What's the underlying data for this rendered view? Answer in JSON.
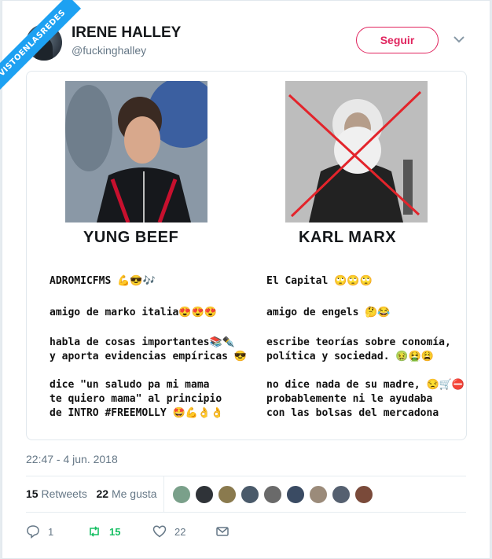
{
  "header": {
    "watermark": "VISTOENLASREDES",
    "display_name": "IRENE HALLEY",
    "handle": "@fuckinghalley",
    "follow_label": "Seguir"
  },
  "image": {
    "left_title": "YUNG BEEF",
    "right_title": "KARL MARX",
    "left_items": [
      [
        "ADROMICFMS 💪😎🎶"
      ],
      [
        "amigo de marko italia😍😍😍"
      ],
      [
        "habla de cosas importantes📚✒️",
        "y aporta evidencias empíricas 😎"
      ],
      [
        "dice \"un saludo pa mi mama",
        "te quiero mama\" al principio",
        "de INTRO #FREEMOLLY 🤩💪👌👌"
      ]
    ],
    "right_items": [
      [
        "El Capital  🙄🙄🙄"
      ],
      [
        "amigo de engels 🤔😂"
      ],
      [
        "escribe teorías sobre conomía,",
        "política y sociedad. 🤢🤮😩"
      ],
      [
        "no dice nada de su madre, 😒🛒⛔",
        "probablemente ni le ayudaba",
        "con las bolsas del mercadona"
      ]
    ]
  },
  "tweet": {
    "timestamp": "22:47 - 4 jun. 2018",
    "retweets_count": "15",
    "retweets_label": "Retweets",
    "likes_count": "22",
    "likes_label": "Me gusta"
  },
  "actions": {
    "reply_count": "1",
    "retweet_count": "15",
    "like_count": "22"
  },
  "colors": {
    "accent": "#1da1f2",
    "follow": "#e0245e",
    "retweet": "#17bf63",
    "muted": "#657786"
  },
  "likers": [
    "liker-1",
    "liker-2",
    "liker-3",
    "liker-4",
    "liker-5",
    "liker-6",
    "liker-7",
    "liker-8",
    "liker-9"
  ]
}
